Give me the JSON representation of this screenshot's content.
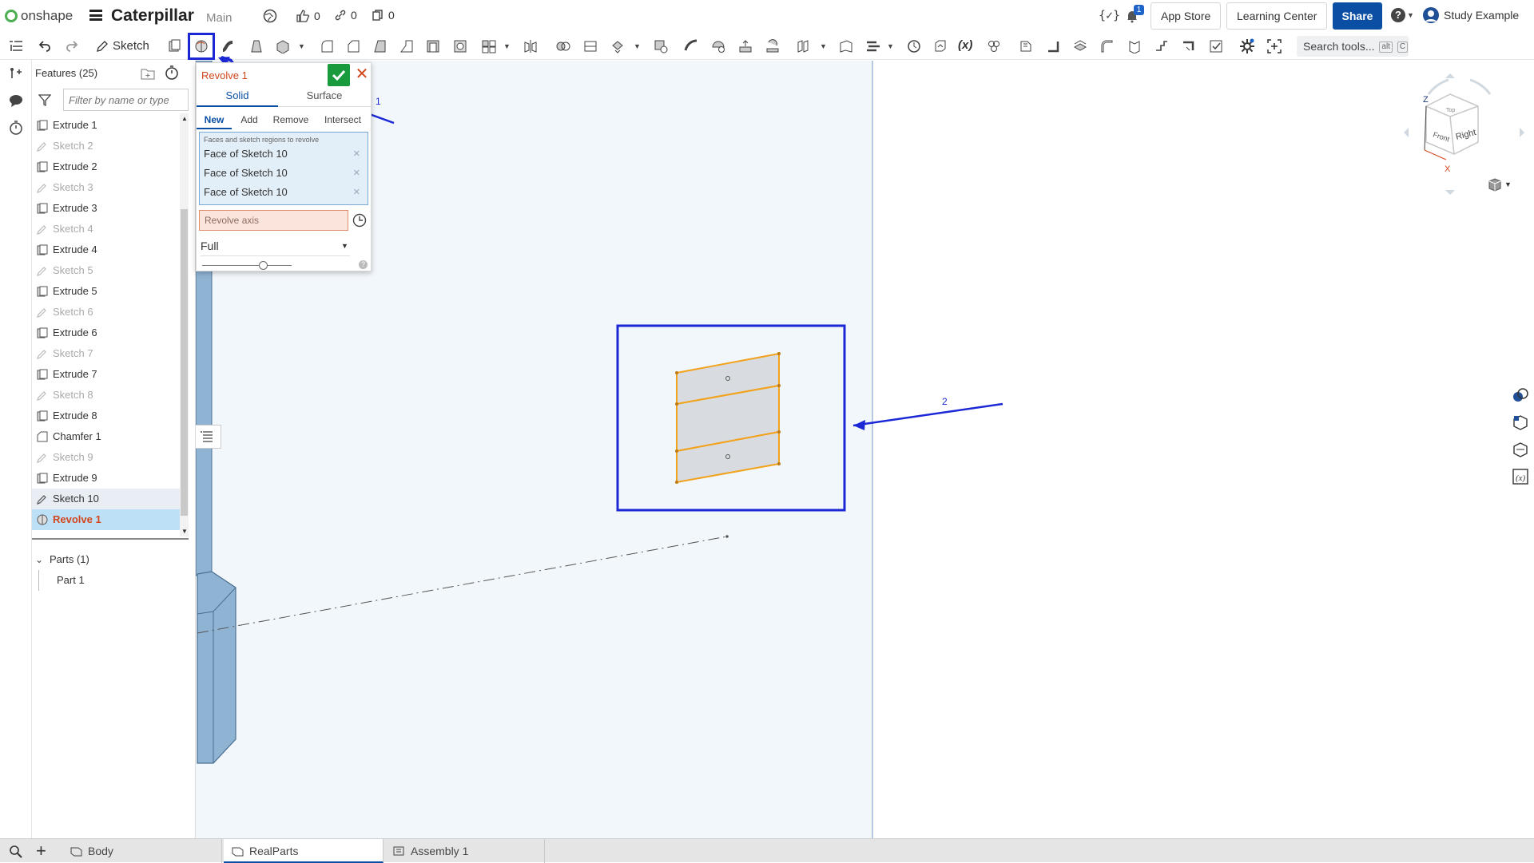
{
  "app": {
    "brand": "onshape",
    "document_title": "Caterpillar",
    "branch": "Main",
    "likes": "0",
    "links": "0",
    "copies": "0",
    "notification_count": "1",
    "app_store_label": "App Store",
    "learning_center_label": "Learning Center",
    "share_label": "Share",
    "user_name": "Study Example"
  },
  "toolbar": {
    "sketch_label": "Sketch",
    "search_label": "Search tools...",
    "search_shortcut_1": "alt",
    "search_shortcut_2": "C"
  },
  "features": {
    "header": "Features (25)",
    "filter_placeholder": "Filter by name or type",
    "items": [
      {
        "label": "Extrude 1",
        "kind": "extrude"
      },
      {
        "label": "Sketch 2",
        "kind": "sketch"
      },
      {
        "label": "Extrude 2",
        "kind": "extrude"
      },
      {
        "label": "Sketch 3",
        "kind": "sketch"
      },
      {
        "label": "Extrude 3",
        "kind": "extrude"
      },
      {
        "label": "Sketch 4",
        "kind": "sketch"
      },
      {
        "label": "Extrude 4",
        "kind": "extrude"
      },
      {
        "label": "Sketch 5",
        "kind": "sketch"
      },
      {
        "label": "Extrude 5",
        "kind": "extrude"
      },
      {
        "label": "Sketch 6",
        "kind": "sketch"
      },
      {
        "label": "Extrude 6",
        "kind": "extrude"
      },
      {
        "label": "Sketch 7",
        "kind": "sketch"
      },
      {
        "label": "Extrude 7",
        "kind": "extrude"
      },
      {
        "label": "Sketch 8",
        "kind": "sketch"
      },
      {
        "label": "Extrude 8",
        "kind": "extrude"
      },
      {
        "label": "Chamfer 1",
        "kind": "chamfer"
      },
      {
        "label": "Sketch 9",
        "kind": "sketch"
      },
      {
        "label": "Extrude 9",
        "kind": "extrude"
      },
      {
        "label": "Sketch 10",
        "kind": "sketch-active"
      },
      {
        "label": "Revolve 1",
        "kind": "revolve"
      }
    ],
    "parts_header": "Parts (1)",
    "parts": [
      "Part 1"
    ]
  },
  "revolve_dialog": {
    "title": "Revolve 1",
    "tab_solid": "Solid",
    "tab_surface": "Surface",
    "op_new": "New",
    "op_add": "Add",
    "op_remove": "Remove",
    "op_intersect": "Intersect",
    "selection_label": "Faces and sketch regions to revolve",
    "selections": [
      "Face of Sketch 10",
      "Face of Sketch 10",
      "Face of Sketch 10"
    ],
    "axis_placeholder": "Revolve axis",
    "revolve_type": "Full",
    "help": "?"
  },
  "view_cube": {
    "axis_z": "Z",
    "axis_x": "X",
    "face_front": "Front",
    "face_right": "Right",
    "face_top": "Top"
  },
  "annotations": {
    "label_1": "1",
    "label_2": "2",
    "color": "#1c28d6"
  },
  "bottom_tabs": [
    "Body",
    "RealParts",
    "Assembly 1"
  ],
  "colors": {
    "accent": "#0b4fa5",
    "feature_active": "#d2461d",
    "sketch_outline": "#f2a21b",
    "part_blue": "#8fb3d3",
    "ok_green": "#189a3d"
  }
}
